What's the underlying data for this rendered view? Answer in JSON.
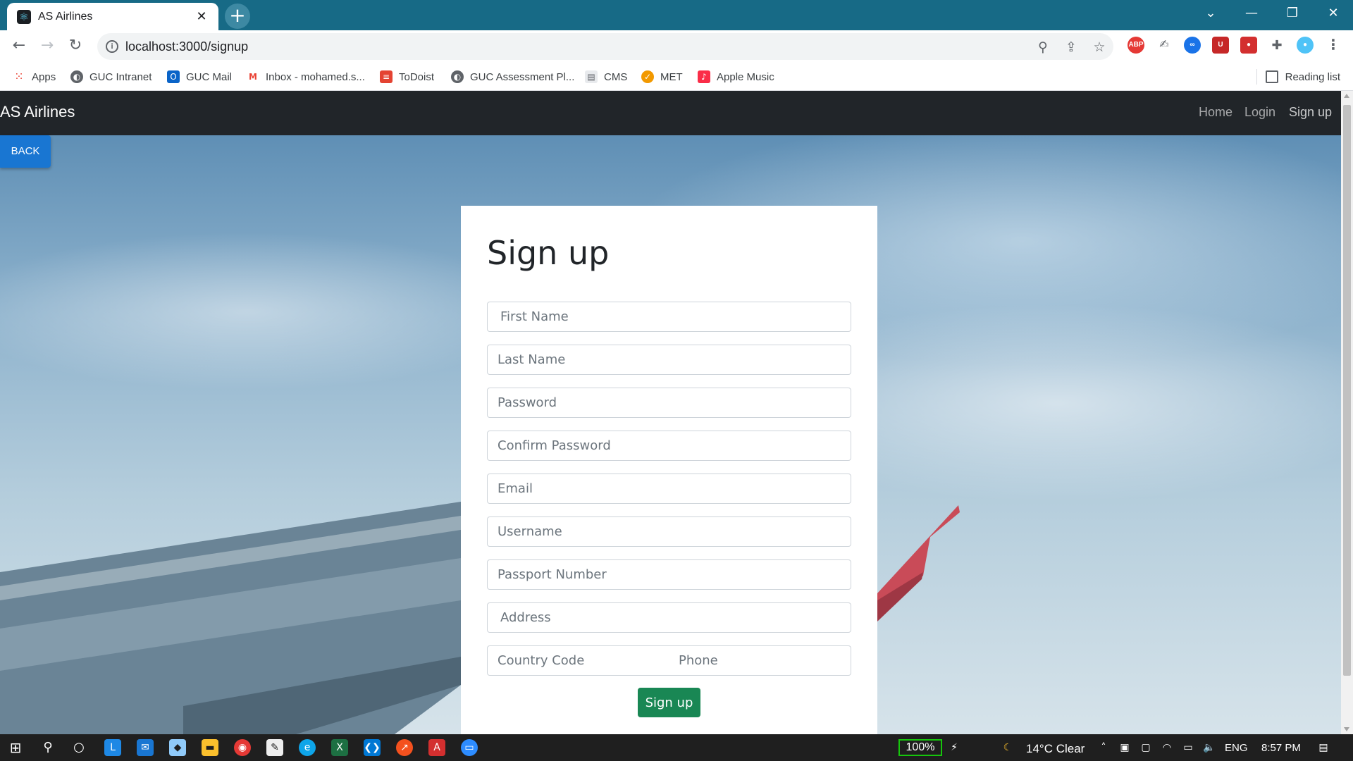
{
  "browser": {
    "tab_title": "AS Airlines",
    "url": "localhost:3000/signup",
    "bookmarks": [
      {
        "label": "Apps",
        "icon": "apps-grid-icon",
        "color": "#ea4335"
      },
      {
        "label": "GUC Intranet",
        "icon": "globe-icon",
        "color": "#5f6368"
      },
      {
        "label": "GUC Mail",
        "icon": "outlook-icon",
        "color": "#0a64c8"
      },
      {
        "label": "Inbox - mohamed.s...",
        "icon": "gmail-icon",
        "color": "#ea4335"
      },
      {
        "label": "ToDoist",
        "icon": "todoist-icon",
        "color": "#e44332"
      },
      {
        "label": "GUC Assessment Pl...",
        "icon": "globe-icon",
        "color": "#5f6368"
      },
      {
        "label": "CMS",
        "icon": "document-icon",
        "color": "#9aa0a6"
      },
      {
        "label": "MET",
        "icon": "met-icon",
        "color": "#f29900"
      },
      {
        "label": "Apple Music",
        "icon": "music-icon",
        "color": "#fa2d48"
      }
    ],
    "reading_list": "Reading list"
  },
  "navbar": {
    "brand": "AS Airlines",
    "links": [
      "Home",
      "Login",
      "Sign up"
    ]
  },
  "back_button": "BACK",
  "form": {
    "title": "Sign up",
    "fields": {
      "first_name": "First Name",
      "last_name": "Last Name",
      "password": "Password",
      "confirm_password": "Confirm Password",
      "email": "Email",
      "username": "Username",
      "passport": "Passport Number",
      "address": "Address",
      "country_code": "Country Code",
      "phone": "Phone"
    },
    "submit": "Sign up"
  },
  "taskbar": {
    "battery": "100%",
    "weather": "14°C  Clear",
    "language": "ENG",
    "time": "8:57 PM"
  },
  "colors": {
    "title_bar": "#176a86",
    "navbar": "#212529",
    "back_button": "#1976d2",
    "submit_button": "#198754"
  }
}
